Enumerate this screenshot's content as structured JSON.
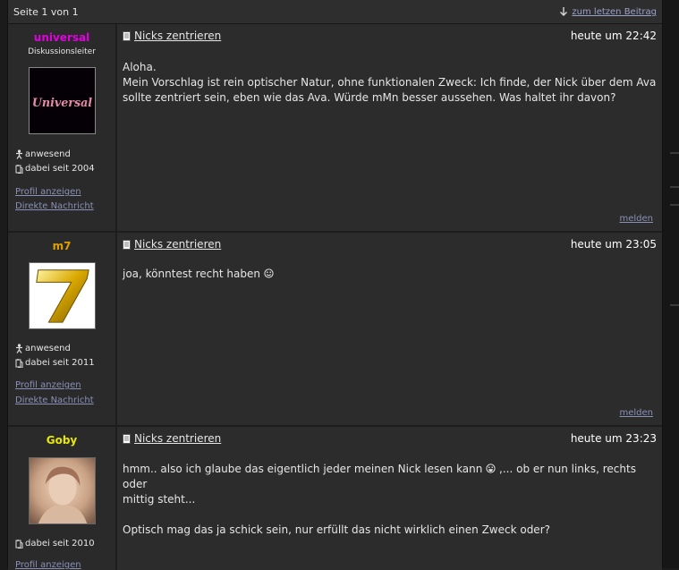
{
  "topbar": {
    "page_info": "Seite 1 von 1",
    "last_post_link": "zum letzen Beitrag"
  },
  "posts": [
    {
      "author": "universal",
      "author_color": "#e000e0",
      "rank": "Diskussionsleiter",
      "avatar_text": "Universal",
      "status": "anwesend",
      "member_since": "dabei seit 2004",
      "profile_link": "Profil anzeigen",
      "message_link": "Direkte Nachricht",
      "title": "Nicks zentrieren",
      "time": "heute um 22:42",
      "line1": "Aloha.",
      "line2": "Mein Vorschlag ist rein optischer Natur, ohne funktionalen Zweck: Ich finde, der Nick über dem Ava",
      "line3": "sollte zentriert sein, eben wie das Ava. Würde mMn besser aussehen. Was haltet ihr davon?",
      "report": "melden"
    },
    {
      "author": "m7",
      "author_color": "#e0a000",
      "status": "anwesend",
      "member_since": "dabei seit 2011",
      "profile_link": "Profil anzeigen",
      "message_link": "Direkte Nachricht",
      "title": "Nicks zentrieren",
      "time": "heute um 23:05",
      "line1": "joa, könntest recht haben",
      "report": "melden"
    },
    {
      "author": "Goby",
      "author_color": "#e8e800",
      "member_since": "dabei seit 2010",
      "profile_link": "Profil anzeigen",
      "title": "Nicks zentrieren",
      "time": "heute um 23:23",
      "line1a": "hmm.. also ich glaube das eigentlich jeder meinen Nick lesen kann",
      "line1b": ",... ob er nun links, rechts oder",
      "line2": "mittig steht...",
      "line3": "Optisch mag das ja schick sein, nur erfüllt das nicht wirklich einen Zweck oder?"
    }
  ]
}
